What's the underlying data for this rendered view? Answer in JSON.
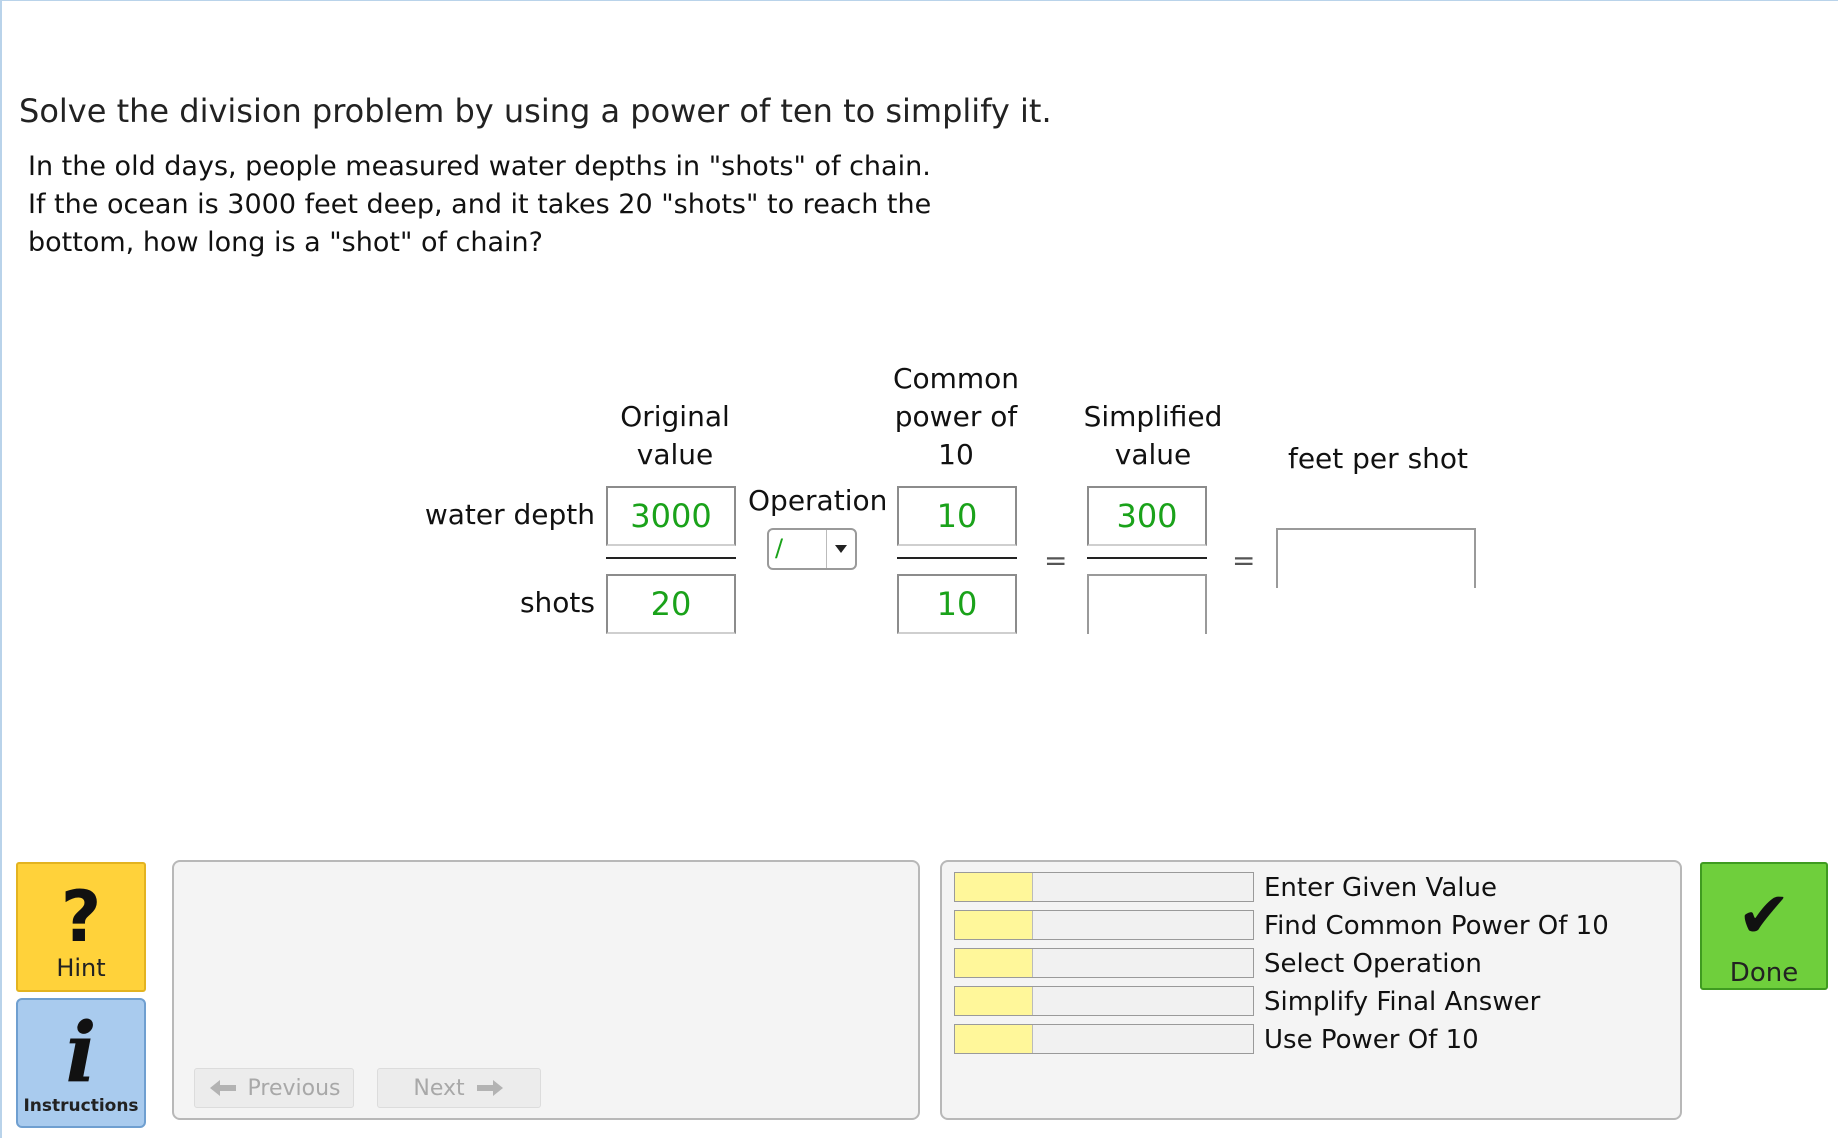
{
  "title": "Solve the division problem by using a power of ten to simplify it.",
  "problem_lines": [
    "In the old days, people measured water depths in \"shots\" of chain.",
    "If the ocean is 3000 feet deep, and it takes 20 \"shots\" to reach the",
    "bottom, how long is a \"shot\" of chain?"
  ],
  "headers": {
    "original": [
      "Original",
      "value"
    ],
    "common": [
      "Common",
      "power of",
      "10"
    ],
    "simplified": [
      "Simplified",
      "value"
    ],
    "result": "feet per shot"
  },
  "rows": {
    "top_label": "water depth",
    "bottom_label": "shots"
  },
  "values": {
    "original_numerator": "3000",
    "original_denominator": "20",
    "common_numerator": "10",
    "common_denominator": "10",
    "simplified_numerator": "300",
    "simplified_denominator": "",
    "result": ""
  },
  "operation": {
    "label": "Operation",
    "selected": "/"
  },
  "equals": "=",
  "buttons": {
    "hint": "Hint",
    "instructions": "Instructions",
    "previous": "Previous",
    "next": "Next",
    "done": "Done"
  },
  "skills": [
    {
      "label": "Enter Given Value",
      "progress": 0.26
    },
    {
      "label": "Find Common Power Of 10",
      "progress": 0.26
    },
    {
      "label": "Select Operation",
      "progress": 0.26
    },
    {
      "label": "Simplify Final Answer",
      "progress": 0.26
    },
    {
      "label": "Use Power Of 10",
      "progress": 0.26
    }
  ],
  "colors": {
    "correct_value": "#1aa21a",
    "hint": "#ffd23a",
    "instructions": "#a9cbee",
    "done": "#6fcf3c",
    "skill_fill": "#fff79a"
  }
}
